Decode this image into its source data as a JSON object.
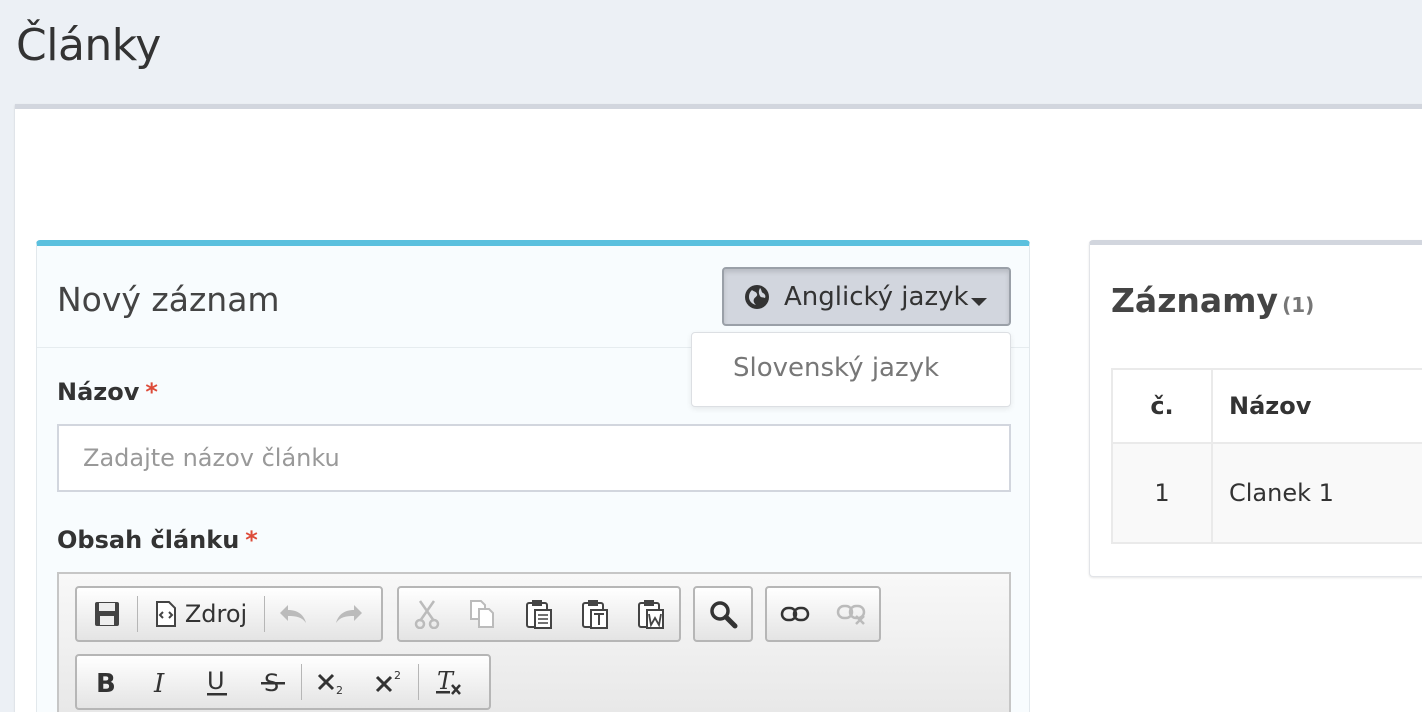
{
  "page": {
    "title": "Články"
  },
  "new_record": {
    "title": "Nový záznam",
    "language_button": {
      "label": "Anglický jazyk",
      "icon": "globe-icon"
    },
    "language_menu": [
      "Slovenský jazyk"
    ],
    "fields": {
      "name": {
        "label": "Názov",
        "required_mark": "*",
        "value": "",
        "placeholder": "Zadajte názov článku"
      },
      "content": {
        "label": "Obsah článku",
        "required_mark": "*"
      }
    },
    "toolbar": {
      "row1": [
        {
          "group": "document",
          "items": [
            "save-icon",
            "source-icon",
            "undo-icon",
            "redo-icon"
          ],
          "source_label": "Zdroj"
        },
        {
          "group": "clipboard",
          "items": [
            "cut-icon",
            "copy-icon",
            "paste-icon",
            "paste-text-icon",
            "paste-word-icon"
          ]
        },
        {
          "group": "find",
          "items": [
            "find-icon"
          ]
        },
        {
          "group": "links",
          "items": [
            "link-icon",
            "unlink-icon"
          ]
        }
      ],
      "row2": [
        {
          "group": "basicstyles",
          "items": [
            "bold-icon",
            "italic-icon",
            "underline-icon",
            "strike-icon",
            "subscript-icon",
            "superscript-icon",
            "remove-format-icon"
          ]
        }
      ]
    }
  },
  "records": {
    "title": "Záznamy",
    "count": "(1)",
    "columns": [
      "č.",
      "Názov"
    ],
    "rows": [
      {
        "num": "1",
        "name": "Clanek 1"
      }
    ]
  },
  "colors": {
    "accent": "#5bc0de",
    "required": "#dd4b39",
    "background": "#ecf0f5"
  }
}
